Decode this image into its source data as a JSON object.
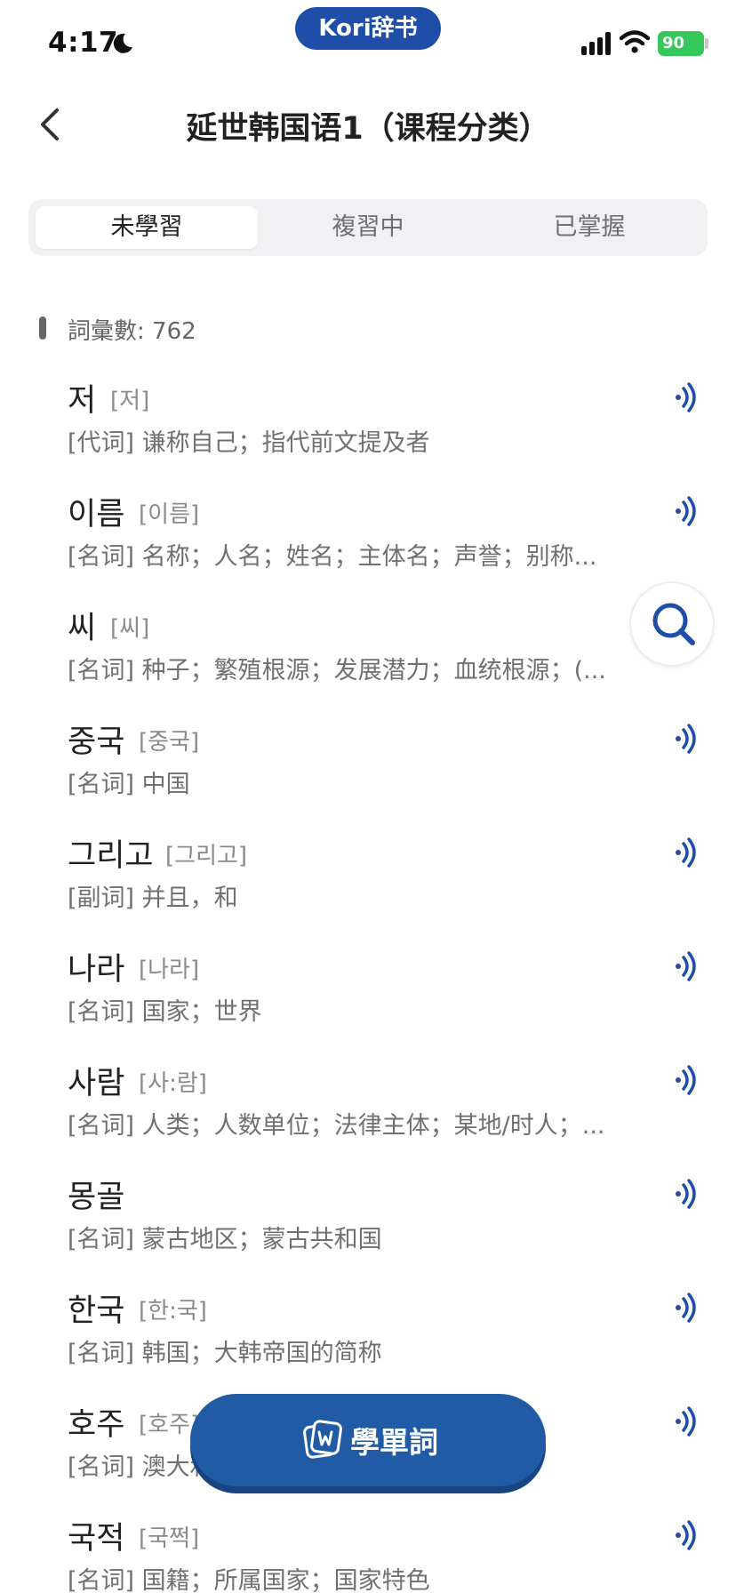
{
  "status_bar": {
    "time": "4:17",
    "brand": "Kori辞书",
    "battery": "90"
  },
  "header": {
    "title": "延世韩国语1（课程分类）"
  },
  "tabs": [
    {
      "label": "未學習",
      "active": true
    },
    {
      "label": "複習中",
      "active": false
    },
    {
      "label": "已掌握",
      "active": false
    }
  ],
  "word_count": {
    "label": "詞彙數: 762"
  },
  "words": [
    {
      "headword": "저",
      "pron": "[저]",
      "definition": "[代词] 谦称自己；指代前文提及者"
    },
    {
      "headword": "이름",
      "pron": "[이름]",
      "definition": "[名词] 名称；人名；姓名；主体名；声誉；别称..."
    },
    {
      "headword": "씨",
      "pron": "[씨]",
      "definition": "[名词] 种子；繁殖根源；发展潜力；血统根源；(..."
    },
    {
      "headword": "중국",
      "pron": "[중국]",
      "definition": "[名词] 中国"
    },
    {
      "headword": "그리고",
      "pron": "[그리고]",
      "definition": "[副词] 并且，和"
    },
    {
      "headword": "나라",
      "pron": "[나라]",
      "definition": "[名词] 国家；世界"
    },
    {
      "headword": "사람",
      "pron": "[사:람]",
      "definition": "[名词] 人类；人数单位；法律主体；某地/时人；..."
    },
    {
      "headword": "몽골",
      "pron": "",
      "definition": "[名词] 蒙古地区；蒙古共和国"
    },
    {
      "headword": "한국",
      "pron": "[한:국]",
      "definition": "[名词] 韩国；大韩帝国的简称"
    },
    {
      "headword": "호주",
      "pron": "[호주]",
      "definition": "[名词] 澳大利亚"
    },
    {
      "headword": "국적",
      "pron": "[국쩍]",
      "definition": "[名词] 国籍；所属国家；国家特色"
    }
  ],
  "learn_button": {
    "label": "學單詞"
  },
  "colors": {
    "accent": "#215ba5",
    "brand_pill": "#1e4ea8",
    "battery": "#34c759",
    "audio_icon": "#1e4ea8"
  }
}
